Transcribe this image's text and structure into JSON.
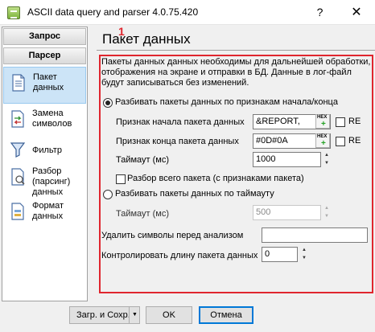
{
  "window": {
    "title": "ASCII data query and parser 4.0.75.420",
    "help_symbol": "?",
    "close_symbol": "✕"
  },
  "sidebar": {
    "tabs": [
      {
        "label": "Запрос"
      },
      {
        "label": "Парсер"
      }
    ],
    "items": [
      {
        "label": "Пакет данных",
        "icon": "document-icon",
        "active": true
      },
      {
        "label": "Замена символов",
        "icon": "replace-icon",
        "active": false
      },
      {
        "label": "Фильтр",
        "icon": "filter-funnel-icon",
        "active": false
      },
      {
        "label": "Разбор (парсинг) данных",
        "icon": "parse-document-icon",
        "active": false
      },
      {
        "label": "Формат данных",
        "icon": "format-document-icon",
        "active": false
      }
    ]
  },
  "page": {
    "title": "Пакет данных",
    "marker": "1",
    "description": "Пакеты данных данных необходимы для дальнейшей обработки, отображения на экране и отправки в БД. Данные в лог-файл будут записываться без изменений."
  },
  "form": {
    "radio_markers": {
      "label": "Разбивать пакеты данных по признакам начала/конца",
      "checked": true
    },
    "start_marker": {
      "label": "Признак начала пакета данных",
      "value": "&REPORT,",
      "re_label": "RE"
    },
    "end_marker": {
      "label": "Признак конца пакета данных",
      "value": "#0D#0A",
      "re_label": "RE"
    },
    "timeout1": {
      "label": "Таймаут (мс)",
      "value": "1000"
    },
    "parse_whole": {
      "label": "Разбор всего пакета (с признаками пакета)",
      "checked": false
    },
    "radio_timeout": {
      "label": "Разбивать пакеты данных по таймауту",
      "checked": false
    },
    "timeout2": {
      "label": "Таймаут (мс)",
      "value": "500"
    },
    "remove_chars": {
      "label": "Удалить символы перед анализом",
      "value": ""
    },
    "check_length": {
      "label": "Контролировать длину пакета данных",
      "value": "0"
    },
    "hex_button": {
      "label": "HEX",
      "icon": "hex-plus-icon"
    }
  },
  "buttons": {
    "load_save": "Загр. и Сохр.",
    "ok": "OK",
    "cancel": "Отмена"
  },
  "colors": {
    "highlight_border": "#e0262e",
    "active_item_bg": "#cce4f7",
    "default_button_border": "#0078d7"
  }
}
